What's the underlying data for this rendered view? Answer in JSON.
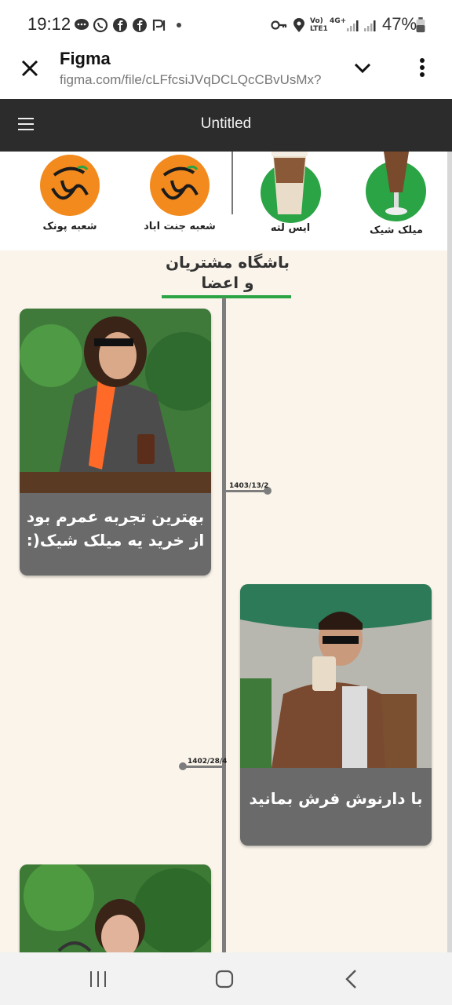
{
  "status_bar": {
    "time": "19:12",
    "network_label": "Vo) LTE1",
    "network_type": "4G+",
    "battery": "47%",
    "left_icons": [
      "chat-bubble-icon",
      "whatsapp-icon",
      "facebook-icon",
      "facebook-icon",
      "p-notification-icon",
      "dot-icon"
    ],
    "right_icons": [
      "key-icon",
      "location-icon",
      "signal-icon",
      "signal-icon",
      "battery-icon"
    ]
  },
  "browser": {
    "title": "Figma",
    "url": "figma.com/file/cLFfcsiJVqDCLQcCBvUsMx?"
  },
  "figma": {
    "file_title": "Untitled"
  },
  "top_row": {
    "items": [
      {
        "label": "میلک شیک",
        "kind": "product",
        "circle_color": "#2aa444"
      },
      {
        "label": "ایس لته",
        "kind": "product",
        "circle_color": "#2aa444"
      },
      {
        "label": "شعبه جنت اباد",
        "kind": "logo",
        "circle_color": "#f28a1e"
      },
      {
        "label": "شعبه پونک",
        "kind": "logo",
        "circle_color": "#f28a1e"
      }
    ]
  },
  "section": {
    "title_line1": "باشگاه مشتریان",
    "title_line2": "و اعضا"
  },
  "timeline": {
    "entries": [
      {
        "date": "1403/13/2",
        "text": "بهترین تجربه عمرم بود از خرید یه میلک شیک(:"
      },
      {
        "date": "1402/28/4",
        "text": "با دارنوش فرش بمانید"
      },
      {
        "date": "",
        "text": ""
      }
    ]
  },
  "colors": {
    "accent_green": "#2aa444",
    "brand_orange": "#f28a1e",
    "figma_header": "#2c2c2c",
    "canvas_bg": "#faf4ea",
    "card_bg": "#6a6a6a"
  }
}
